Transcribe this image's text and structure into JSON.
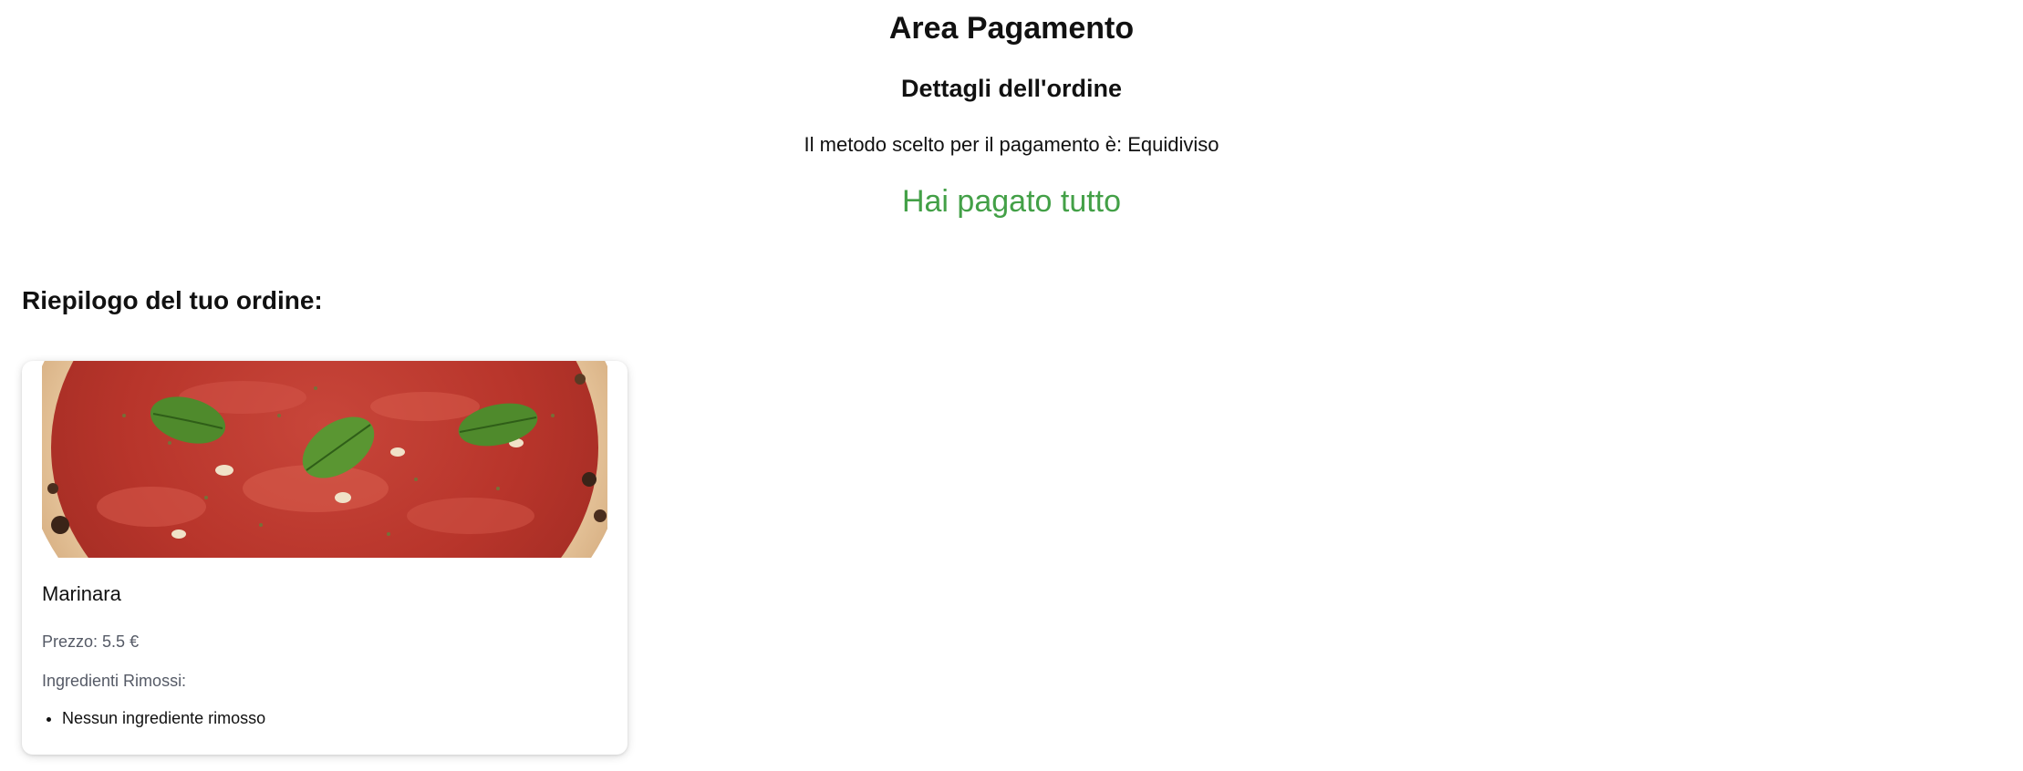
{
  "header": {
    "title": "Area Pagamento",
    "subtitle": "Dettagli dell'ordine",
    "method_label": "Il metodo scelto per il pagamento è:",
    "method_value": "Equidiviso",
    "status": "Hai pagato tutto"
  },
  "summary": {
    "heading": "Riepilogo del tuo ordine:",
    "items": [
      {
        "image": "pizza-marinara-image",
        "name": "Marinara",
        "price_label": "Prezzo:",
        "price_value": "5.5 €",
        "removed_label": "Ingredienti Rimossi:",
        "removed_items": [
          "Nessun ingrediente rimosso"
        ]
      }
    ]
  },
  "colors": {
    "status_green": "#43a047",
    "secondary_text": "#555a66",
    "text": "#111111"
  }
}
